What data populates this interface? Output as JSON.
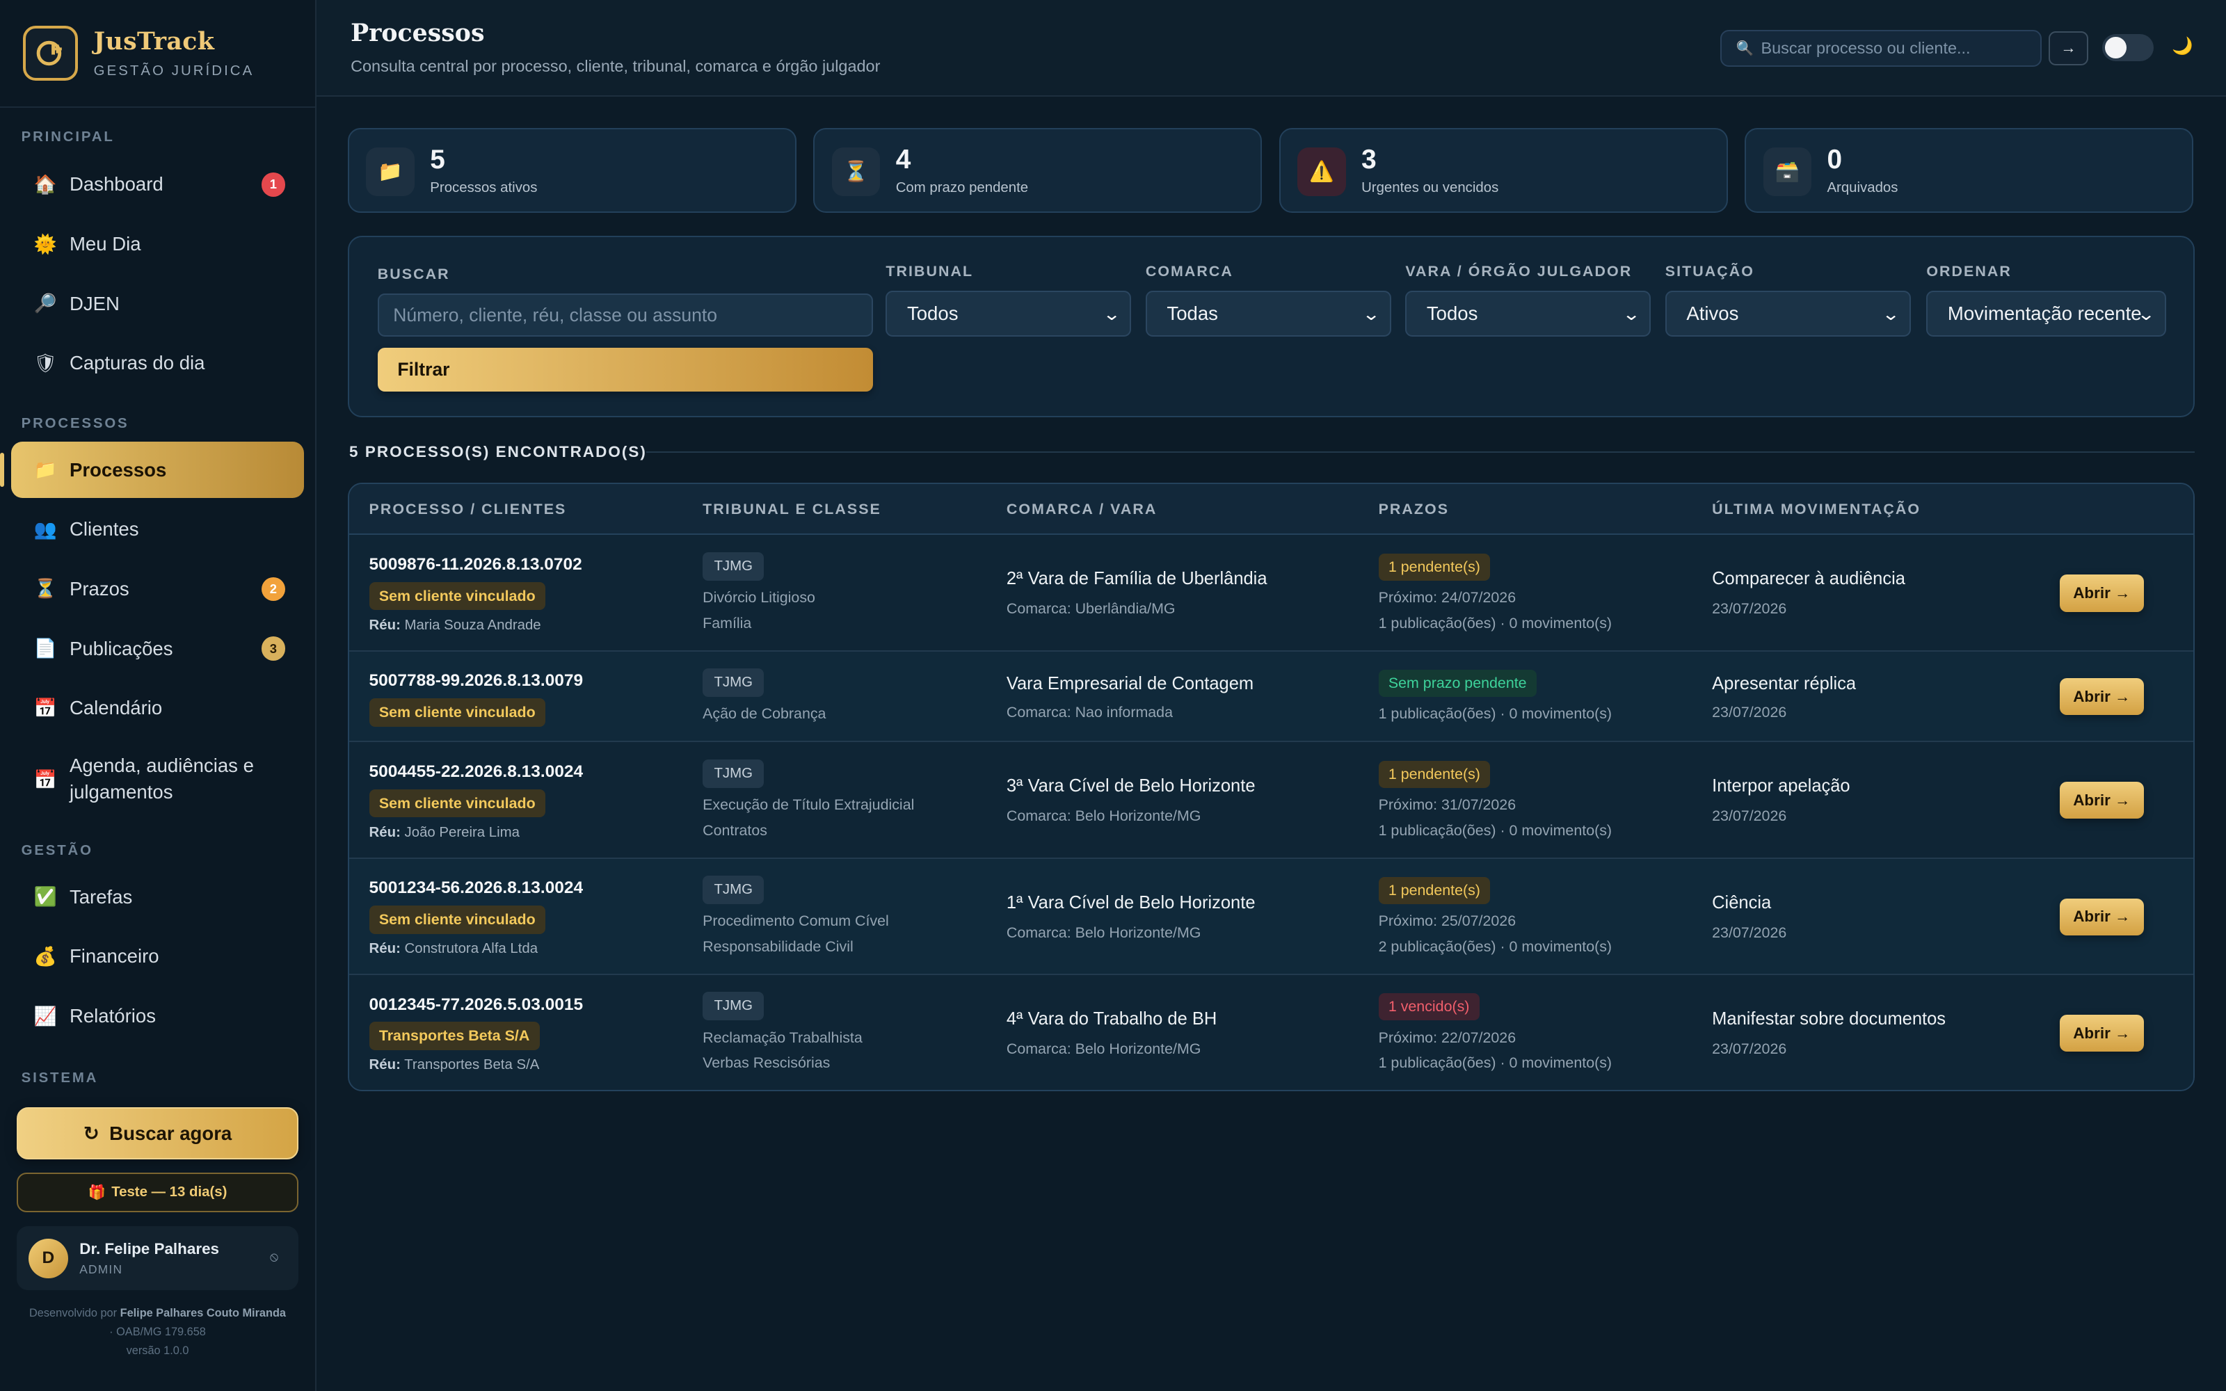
{
  "brand": {
    "name": "JusTrack",
    "subtitle": "GESTÃO JURÍDICA",
    "logo_icon": "scale-icon"
  },
  "sidebar": {
    "sections": {
      "principal": "PRINCIPAL",
      "processos": "PROCESSOS",
      "gestao": "GESTÃO",
      "sistema": "SISTEMA"
    },
    "items": [
      {
        "label": "Dashboard",
        "icon": "house-icon",
        "badge": "1"
      },
      {
        "label": "Meu Dia",
        "icon": "sun-icon"
      },
      {
        "label": "DJEN",
        "icon": "magnifier-icon"
      },
      {
        "label": "Capturas do dia",
        "icon": "shield-icon"
      },
      {
        "label": "Processos",
        "icon": "folder-icon",
        "active": true
      },
      {
        "label": "Clientes",
        "icon": "users-icon"
      },
      {
        "label": "Prazos",
        "icon": "hourglass-icon",
        "badge": "2"
      },
      {
        "label": "Publicações",
        "icon": "document-icon",
        "badge": "3"
      },
      {
        "label": "Calendário",
        "icon": "calendar-icon"
      },
      {
        "label": "Agenda, audiências e julgamentos",
        "label_line1": "Agenda, audiências e",
        "label_line2": "julgamentos",
        "icon": "calendar-icon"
      },
      {
        "label": "Tarefas",
        "icon": "check-icon"
      },
      {
        "label": "Financeiro",
        "icon": "money-bag-icon"
      },
      {
        "label": "Relatórios",
        "icon": "chart-icon"
      }
    ],
    "buscar_agora": "Buscar agora",
    "trial": "Teste — 13 dia(s)",
    "user": {
      "initial": "D",
      "name": "Dr. Felipe Palhares",
      "role": "ADMIN"
    },
    "credit": {
      "prefix": "Desenvolvido por",
      "author": "Felipe Palhares Couto Miranda",
      "oab": "· OAB/MG 179.658",
      "version": "versão 1.0.0"
    }
  },
  "header": {
    "title": "Processos",
    "subtitle": "Consulta central por processo, cliente, tribunal, comarca e órgão julgador",
    "search_placeholder": "Buscar processo ou cliente...",
    "go_label": "→",
    "moon": "🌙"
  },
  "stats": [
    {
      "value": "5",
      "label": "Processos ativos",
      "icon": "folder-icon"
    },
    {
      "value": "4",
      "label": "Com prazo pendente",
      "icon": "hourglass-icon"
    },
    {
      "value": "3",
      "label": "Urgentes ou vencidos",
      "icon": "warning-icon"
    },
    {
      "value": "0",
      "label": "Arquivados",
      "icon": "archive-icon"
    }
  ],
  "filters": {
    "buscar_label": "BUSCAR",
    "buscar_placeholder": "Número, cliente, réu, classe ou assunto",
    "tribunal_label": "TRIBUNAL",
    "tribunal_value": "Todos",
    "comarca_label": "COMARCA",
    "comarca_value": "Todas",
    "vara_label": "VARA / ÓRGÃO JULGADOR",
    "vara_value": "Todos",
    "situacao_label": "SITUAÇÃO",
    "situacao_value": "Ativos",
    "ordenar_label": "ORDENAR",
    "ordenar_value": "Movimentação recente",
    "filtrar": "Filtrar"
  },
  "results": {
    "count_label": "5 PROCESSO(S) ENCONTRADO(S)",
    "headers": [
      "PROCESSO / CLIENTES",
      "TRIBUNAL E CLASSE",
      "COMARCA / VARA",
      "PRAZOS",
      "ÚLTIMA MOVIMENTAÇÃO"
    ],
    "rows": [
      {
        "numero": "5009876-11.2026.8.13.0702",
        "cliente": "Sem cliente vinculado",
        "reu_label": "Réu:",
        "reu": "Maria Souza Andrade",
        "tribunal": "TJMG",
        "classe1": "Divórcio Litigioso",
        "classe2": "Família",
        "vara": "2ª Vara de Família de Uberlândia",
        "comarca": "Comarca: Uberlândia/MG",
        "prazo_tag": "1 pendente(s)",
        "prazo_status": "pending",
        "proximo": "Próximo: 24/07/2026",
        "movimentos": "1 publicação(ões) · 0 movimento(s)",
        "ultima": "Comparecer à audiência",
        "ultima_data": "23/07/2026",
        "abrir": "Abrir →"
      },
      {
        "numero": "5007788-99.2026.8.13.0079",
        "cliente": "Sem cliente vinculado",
        "tribunal": "TJMG",
        "classe1": "Ação de Cobrança",
        "vara": "Vara Empresarial de Contagem",
        "comarca": "Comarca: Nao informada",
        "prazo_tag": "Sem prazo pendente",
        "prazo_status": "none",
        "movimentos": "1 publicação(ões) · 0 movimento(s)",
        "ultima": "Apresentar réplica",
        "ultima_data": "23/07/2026",
        "abrir": "Abrir →"
      },
      {
        "numero": "5004455-22.2026.8.13.0024",
        "cliente": "Sem cliente vinculado",
        "reu_label": "Réu:",
        "reu": "João Pereira Lima",
        "tribunal": "TJMG",
        "classe1": "Execução de Título Extrajudicial",
        "classe2": "Contratos",
        "vara": "3ª Vara Cível de Belo Horizonte",
        "comarca": "Comarca: Belo Horizonte/MG",
        "prazo_tag": "1 pendente(s)",
        "prazo_status": "pending",
        "proximo": "Próximo: 31/07/2026",
        "movimentos": "1 publicação(ões) · 0 movimento(s)",
        "ultima": "Interpor apelação",
        "ultima_data": "23/07/2026",
        "abrir": "Abrir →"
      },
      {
        "numero": "5001234-56.2026.8.13.0024",
        "cliente": "Sem cliente vinculado",
        "reu_label": "Réu:",
        "reu": "Construtora Alfa Ltda",
        "tribunal": "TJMG",
        "classe1": "Procedimento Comum Cível",
        "classe2": "Responsabilidade Civil",
        "vara": "1ª Vara Cível de Belo Horizonte",
        "comarca": "Comarca: Belo Horizonte/MG",
        "prazo_tag": "1 pendente(s)",
        "prazo_status": "pending",
        "proximo": "Próximo: 25/07/2026",
        "movimentos": "2 publicação(ões) · 0 movimento(s)",
        "ultima": "Ciência",
        "ultima_data": "23/07/2026",
        "abrir": "Abrir →"
      },
      {
        "numero": "0012345-77.2026.5.03.0015",
        "cliente": "Transportes Beta S/A",
        "reu_label": "Réu:",
        "reu": "Transportes Beta S/A",
        "tribunal": "TJMG",
        "classe1": "Reclamação Trabalhista",
        "classe2": "Verbas Rescisórias",
        "vara": "4ª Vara do Trabalho de BH",
        "comarca": "Comarca: Belo Horizonte/MG",
        "prazo_tag": "1 vencido(s)",
        "prazo_status": "overdue",
        "proximo": "Próximo: 22/07/2026",
        "movimentos": "1 publicação(ões) · 0 movimento(s)",
        "ultima": "Manifestar sobre documentos",
        "ultima_data": "23/07/2026",
        "abrir": "Abrir →"
      }
    ]
  },
  "colors": {
    "accent": "#e7c46c",
    "background": "#0c1b27",
    "panel": "#12283a",
    "danger": "#e5484d",
    "success": "#3ed39b"
  }
}
